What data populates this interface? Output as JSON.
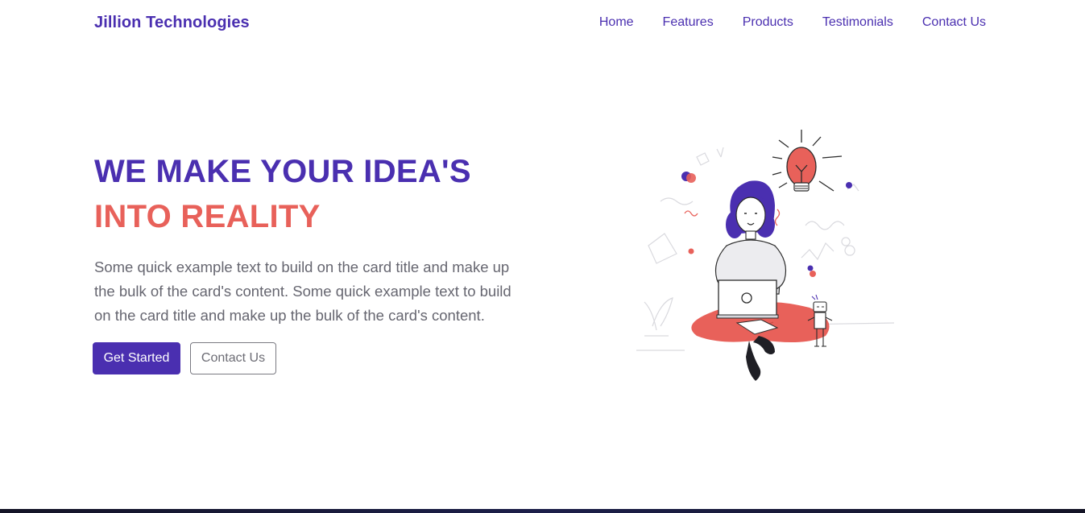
{
  "navbar": {
    "brand": "Jillion Technologies",
    "links": [
      {
        "label": "Home"
      },
      {
        "label": "Features"
      },
      {
        "label": "Products"
      },
      {
        "label": "Testimonials"
      },
      {
        "label": "Contact Us"
      }
    ]
  },
  "hero": {
    "headline_line1": "WE MAKE YOUR IDEA'S",
    "headline_line2": "INTO REALITY",
    "lead": "Some quick example text to build on the card title and make up the bulk of the card's content. Some quick example text to build on the card title and make up the bulk of the card's content.",
    "primary_button": "Get Started",
    "secondary_button": "Contact Us",
    "illustration_icon": "person-with-laptop-and-lightbulb-illustration"
  },
  "colors": {
    "brand": "#4a2fb0",
    "accent": "#e8615a",
    "text_muted": "#666670"
  }
}
